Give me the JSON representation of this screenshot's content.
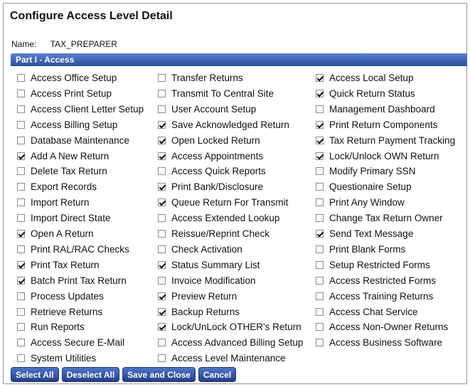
{
  "title": "Configure Access Level Detail",
  "name_label": "Name:",
  "name_value": "TAX_PREPARER",
  "section_title": "Part I - Access",
  "columns": [
    [
      {
        "label": "Access Office Setup",
        "checked": false
      },
      {
        "label": "Access Print Setup",
        "checked": false
      },
      {
        "label": "Access Client Letter Setup",
        "checked": false
      },
      {
        "label": "Access Billing Setup",
        "checked": false
      },
      {
        "label": "Database Maintenance",
        "checked": false
      },
      {
        "label": "Add A New Return",
        "checked": true
      },
      {
        "label": "Delete Tax Return",
        "checked": false
      },
      {
        "label": "Export Records",
        "checked": false
      },
      {
        "label": "Import Return",
        "checked": false
      },
      {
        "label": "Import Direct State",
        "checked": false
      },
      {
        "label": "Open A Return",
        "checked": true
      },
      {
        "label": "Print RAL/RAC Checks",
        "checked": false
      },
      {
        "label": "Print Tax Return",
        "checked": true
      },
      {
        "label": "Batch Print Tax Return",
        "checked": true
      },
      {
        "label": "Process Updates",
        "checked": false
      },
      {
        "label": "Retrieve Returns",
        "checked": false
      },
      {
        "label": "Run Reports",
        "checked": false
      },
      {
        "label": "Access Secure E-Mail",
        "checked": false
      },
      {
        "label": "System Utilities",
        "checked": false
      }
    ],
    [
      {
        "label": "Transfer Returns",
        "checked": false
      },
      {
        "label": "Transmit To Central Site",
        "checked": false
      },
      {
        "label": "User Account Setup",
        "checked": false
      },
      {
        "label": "Save Acknowledged Return",
        "checked": true
      },
      {
        "label": "Open Locked Return",
        "checked": true
      },
      {
        "label": "Access Appointments",
        "checked": true
      },
      {
        "label": "Access Quick Reports",
        "checked": false
      },
      {
        "label": "Print Bank/Disclosure",
        "checked": true
      },
      {
        "label": "Queue Return For Transmit",
        "checked": true
      },
      {
        "label": "Access Extended Lookup",
        "checked": false
      },
      {
        "label": "Reissue/Reprint Check",
        "checked": false
      },
      {
        "label": "Check Activation",
        "checked": false
      },
      {
        "label": "Status Summary List",
        "checked": true
      },
      {
        "label": "Invoice Modification",
        "checked": false
      },
      {
        "label": "Preview Return",
        "checked": true
      },
      {
        "label": "Backup Returns",
        "checked": true
      },
      {
        "label": "Lock/UnLock OTHER's Return",
        "checked": true
      },
      {
        "label": "Access Advanced Billing Setup",
        "checked": false
      },
      {
        "label": "Access Level Maintenance",
        "checked": false
      }
    ],
    [
      {
        "label": "Access Local Setup",
        "checked": true
      },
      {
        "label": "Quick Return Status",
        "checked": true
      },
      {
        "label": "Management Dashboard",
        "checked": false
      },
      {
        "label": "Print Return Components",
        "checked": true
      },
      {
        "label": "Tax Return Payment Tracking",
        "checked": true
      },
      {
        "label": "Lock/Unlock OWN Return",
        "checked": true
      },
      {
        "label": "Modify Primary SSN",
        "checked": false
      },
      {
        "label": "Questionaire Setup",
        "checked": false
      },
      {
        "label": "Print Any Window",
        "checked": false
      },
      {
        "label": "Change Tax Return Owner",
        "checked": false
      },
      {
        "label": "Send Text Message",
        "checked": true
      },
      {
        "label": "Print Blank Forms",
        "checked": false
      },
      {
        "label": "Setup Restricted Forms",
        "checked": false
      },
      {
        "label": "Access Restricted Forms",
        "checked": false
      },
      {
        "label": "Access Training Returns",
        "checked": false
      },
      {
        "label": "Access Chat Service",
        "checked": false
      },
      {
        "label": "Access Non-Owner Returns",
        "checked": false
      },
      {
        "label": "Access Business Software",
        "checked": false
      }
    ]
  ],
  "buttons": {
    "select_all": "Select All",
    "deselect_all": "Deselect All",
    "save_close": "Save and Close",
    "cancel": "Cancel"
  }
}
